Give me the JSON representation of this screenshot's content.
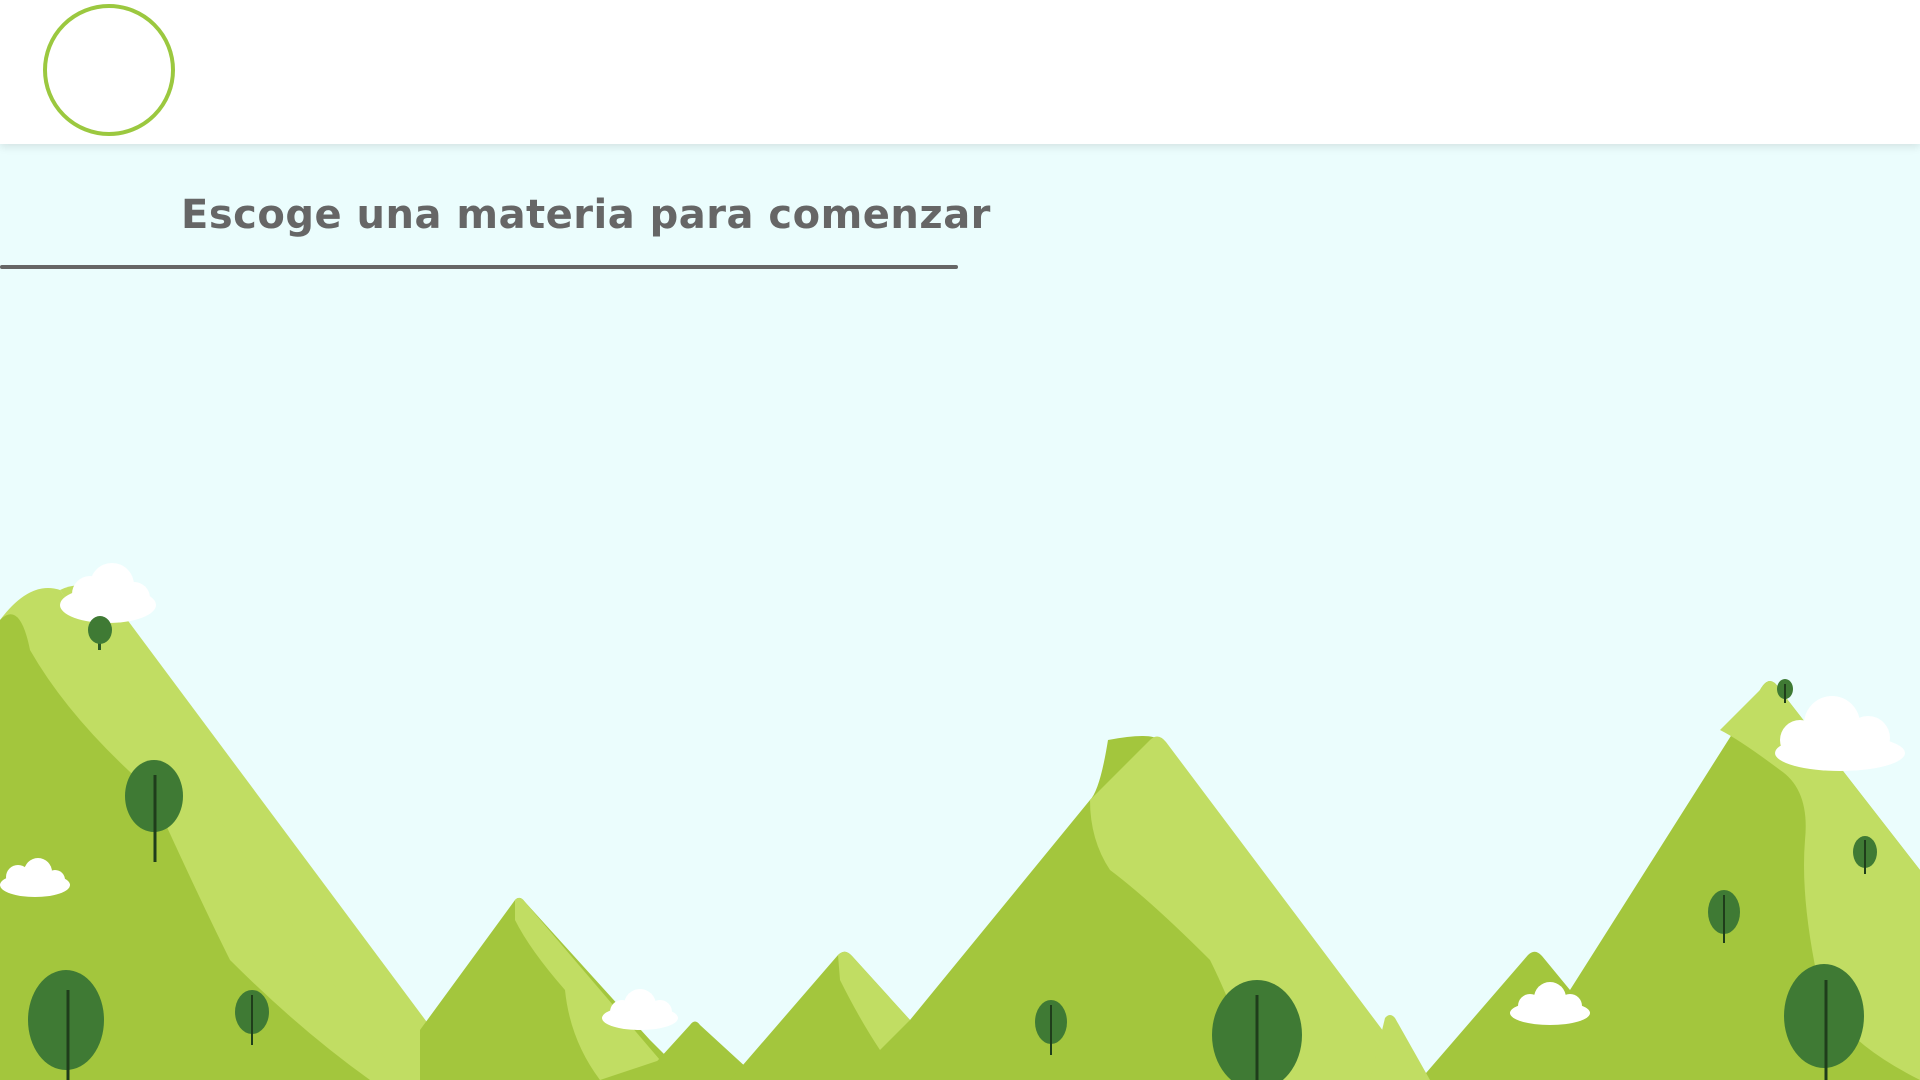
{
  "header": {
    "avatar_icon": "user-avatar-icon",
    "accent_color": "#9bc83f"
  },
  "main": {
    "heading": "Escoge una materia para comenzar",
    "heading_color": "#666666",
    "background_color": "#ebfdfd"
  },
  "landscape": {
    "description_icon": "mountains-illustration",
    "colors": {
      "mountain_light": "#c1dd63",
      "mountain_dark": "#a3c63d",
      "tree": "#3f7a34",
      "cloud": "#ffffff"
    }
  }
}
